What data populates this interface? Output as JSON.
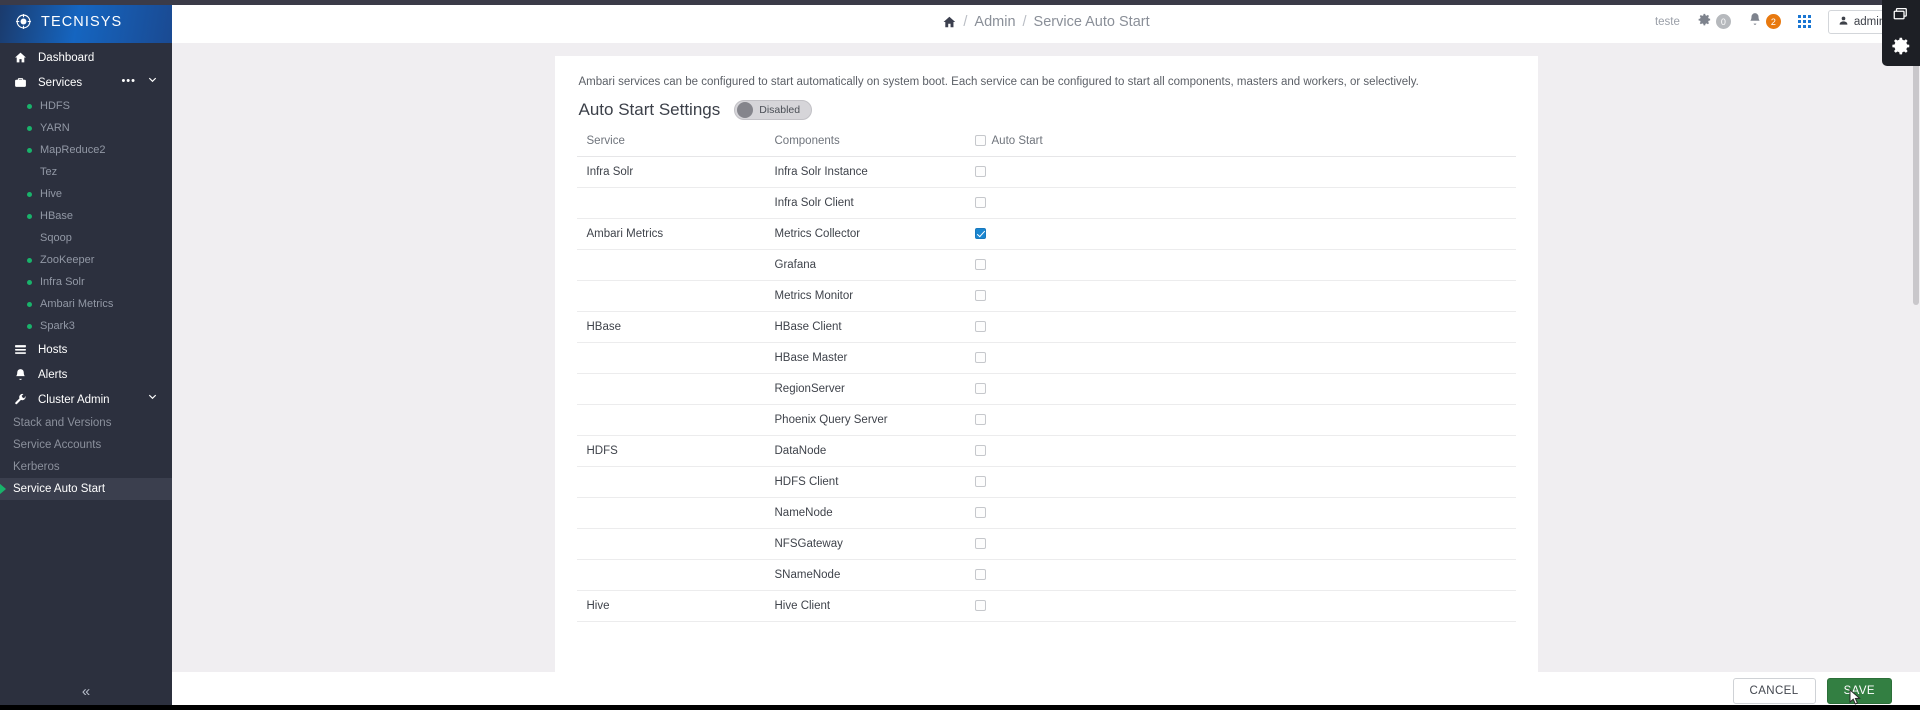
{
  "brand": {
    "name": "TECNISYS",
    "logo_icon": "target-logo-icon"
  },
  "sidebar": {
    "primary": [
      {
        "label": "Dashboard",
        "icon": "home-icon"
      },
      {
        "label": "Services",
        "icon": "briefcase-icon",
        "has_dots": true,
        "has_chevron": true
      }
    ],
    "services": [
      {
        "label": "HDFS",
        "status": "green"
      },
      {
        "label": "YARN",
        "status": "green"
      },
      {
        "label": "MapReduce2",
        "status": "green"
      },
      {
        "label": "Tez",
        "status": "none"
      },
      {
        "label": "Hive",
        "status": "green"
      },
      {
        "label": "HBase",
        "status": "green"
      },
      {
        "label": "Sqoop",
        "status": "none"
      },
      {
        "label": "ZooKeeper",
        "status": "green"
      },
      {
        "label": "Infra Solr",
        "status": "green"
      },
      {
        "label": "Ambari Metrics",
        "status": "green"
      },
      {
        "label": "Spark3",
        "status": "green"
      }
    ],
    "after_services": [
      {
        "label": "Hosts",
        "icon": "hosts-icon"
      },
      {
        "label": "Alerts",
        "icon": "bell-icon"
      },
      {
        "label": "Cluster Admin",
        "icon": "wrench-icon",
        "has_chevron": true
      }
    ],
    "admin_items": [
      {
        "label": "Stack and Versions",
        "active": false
      },
      {
        "label": "Service Accounts",
        "active": false
      },
      {
        "label": "Kerberos",
        "active": false
      },
      {
        "label": "Service Auto Start",
        "active": true
      }
    ],
    "collapse_icon": "chevron-double-left-icon"
  },
  "header": {
    "home_icon": "home-icon",
    "breadcrumb": [
      "Admin",
      "Service Auto Start"
    ],
    "separator": "/",
    "user_text": "teste",
    "gear_icon": "gear-icon",
    "gear_count": "0",
    "bell_icon": "bell-icon",
    "bell_count": "2",
    "apps_icon": "grid-apps-icon",
    "account_label": "admin",
    "account_caret": "▾"
  },
  "main": {
    "intro": "Ambari services can be configured to start automatically on system boot. Each service can be configured to start all components, masters and workers, or selectively.",
    "settings_title": "Auto Start Settings",
    "toggle_label": "Disabled",
    "toggle_state": "off",
    "columns": [
      "Service",
      "Components",
      "Auto Start"
    ],
    "header_checkbox_checked": false,
    "rows": [
      {
        "service": "Infra Solr",
        "component": "Infra Solr Instance",
        "checked": false,
        "group_start": true
      },
      {
        "service": "",
        "component": "Infra Solr Client",
        "checked": false,
        "group_start": false
      },
      {
        "service": "Ambari Metrics",
        "component": "Metrics Collector",
        "checked": true,
        "group_start": true
      },
      {
        "service": "",
        "component": "Grafana",
        "checked": false,
        "group_start": false
      },
      {
        "service": "",
        "component": "Metrics Monitor",
        "checked": false,
        "group_start": false
      },
      {
        "service": "HBase",
        "component": "HBase Client",
        "checked": false,
        "group_start": true
      },
      {
        "service": "",
        "component": "HBase Master",
        "checked": false,
        "group_start": false
      },
      {
        "service": "",
        "component": "RegionServer",
        "checked": false,
        "group_start": false
      },
      {
        "service": "",
        "component": "Phoenix Query Server",
        "checked": false,
        "group_start": false
      },
      {
        "service": "HDFS",
        "component": "DataNode",
        "checked": false,
        "group_start": true
      },
      {
        "service": "",
        "component": "HDFS Client",
        "checked": false,
        "group_start": false
      },
      {
        "service": "",
        "component": "NameNode",
        "checked": false,
        "group_start": false
      },
      {
        "service": "",
        "component": "NFSGateway",
        "checked": false,
        "group_start": false
      },
      {
        "service": "",
        "component": "SNameNode",
        "checked": false,
        "group_start": false
      },
      {
        "service": "Hive",
        "component": "Hive Client",
        "checked": false,
        "group_start": true
      }
    ]
  },
  "footer": {
    "cancel_label": "CANCEL",
    "save_label": "SAVE"
  },
  "float_panel": {
    "window_icon": "windows-restore-icon",
    "gear_icon": "gear-icon"
  },
  "colors": {
    "sidebar_bg": "#2c303e",
    "brand_blue": "#1565c0",
    "status_green": "#19b36b",
    "accent_blue": "#1a86d0",
    "save_green": "#337f42",
    "badge_orange": "#e8790f",
    "content_bg": "#f0eef1"
  }
}
